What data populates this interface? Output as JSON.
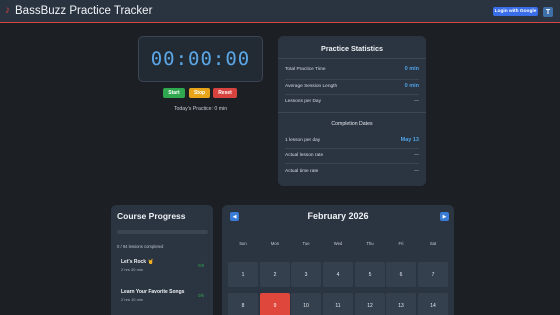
{
  "header": {
    "title": "BassBuzz Practice Tracker",
    "logo_icon": "guitar-icon",
    "login_label": "Login with Google",
    "theme_label": "T"
  },
  "timer": {
    "display": "00:00:00",
    "start_label": "Start",
    "stop_label": "Stop",
    "reset_label": "Reset",
    "today_label": "Today's Practice: 0 min"
  },
  "stats": {
    "title": "Practice Statistics",
    "total_label": "Total Practice Time",
    "total_value": "0 min",
    "avg_label": "Average Session Length",
    "avg_value": "0 min",
    "lessons_label": "Lessons per Day",
    "lessons_value": "—",
    "completion_title": "Completion Dates",
    "one_lesson_label": "1 lesson per day",
    "one_lesson_value": "May 13",
    "actual_lesson_label": "Actual lesson rate",
    "actual_lesson_value": "—",
    "actual_time_label": "Actual time rate",
    "actual_time_value": "—"
  },
  "course": {
    "title": "Course Progress",
    "progress_fraction": 0,
    "completed_label": "0 / 94 lessons completed",
    "items": [
      {
        "name": "Let's Rock 🤘",
        "duration": "2 hrs 30 min",
        "count": "0/9"
      },
      {
        "name": "Learn Your Favorite Songs",
        "duration": "2 hrs 10 min",
        "count": "0/6"
      }
    ]
  },
  "calendar": {
    "month": "February 2026",
    "prev_label": "◀",
    "next_label": "▶",
    "weekdays": [
      "Sun",
      "Mon",
      "Tue",
      "Wed",
      "Thu",
      "Fri",
      "Sat"
    ],
    "days": [
      "1",
      "2",
      "3",
      "4",
      "5",
      "6",
      "7",
      "8",
      "9",
      "10",
      "11",
      "12",
      "13",
      "14"
    ],
    "today": "9"
  },
  "colors": {
    "accent": "#5aa7e8",
    "header_border": "#d94545",
    "today": "#e0473c"
  }
}
